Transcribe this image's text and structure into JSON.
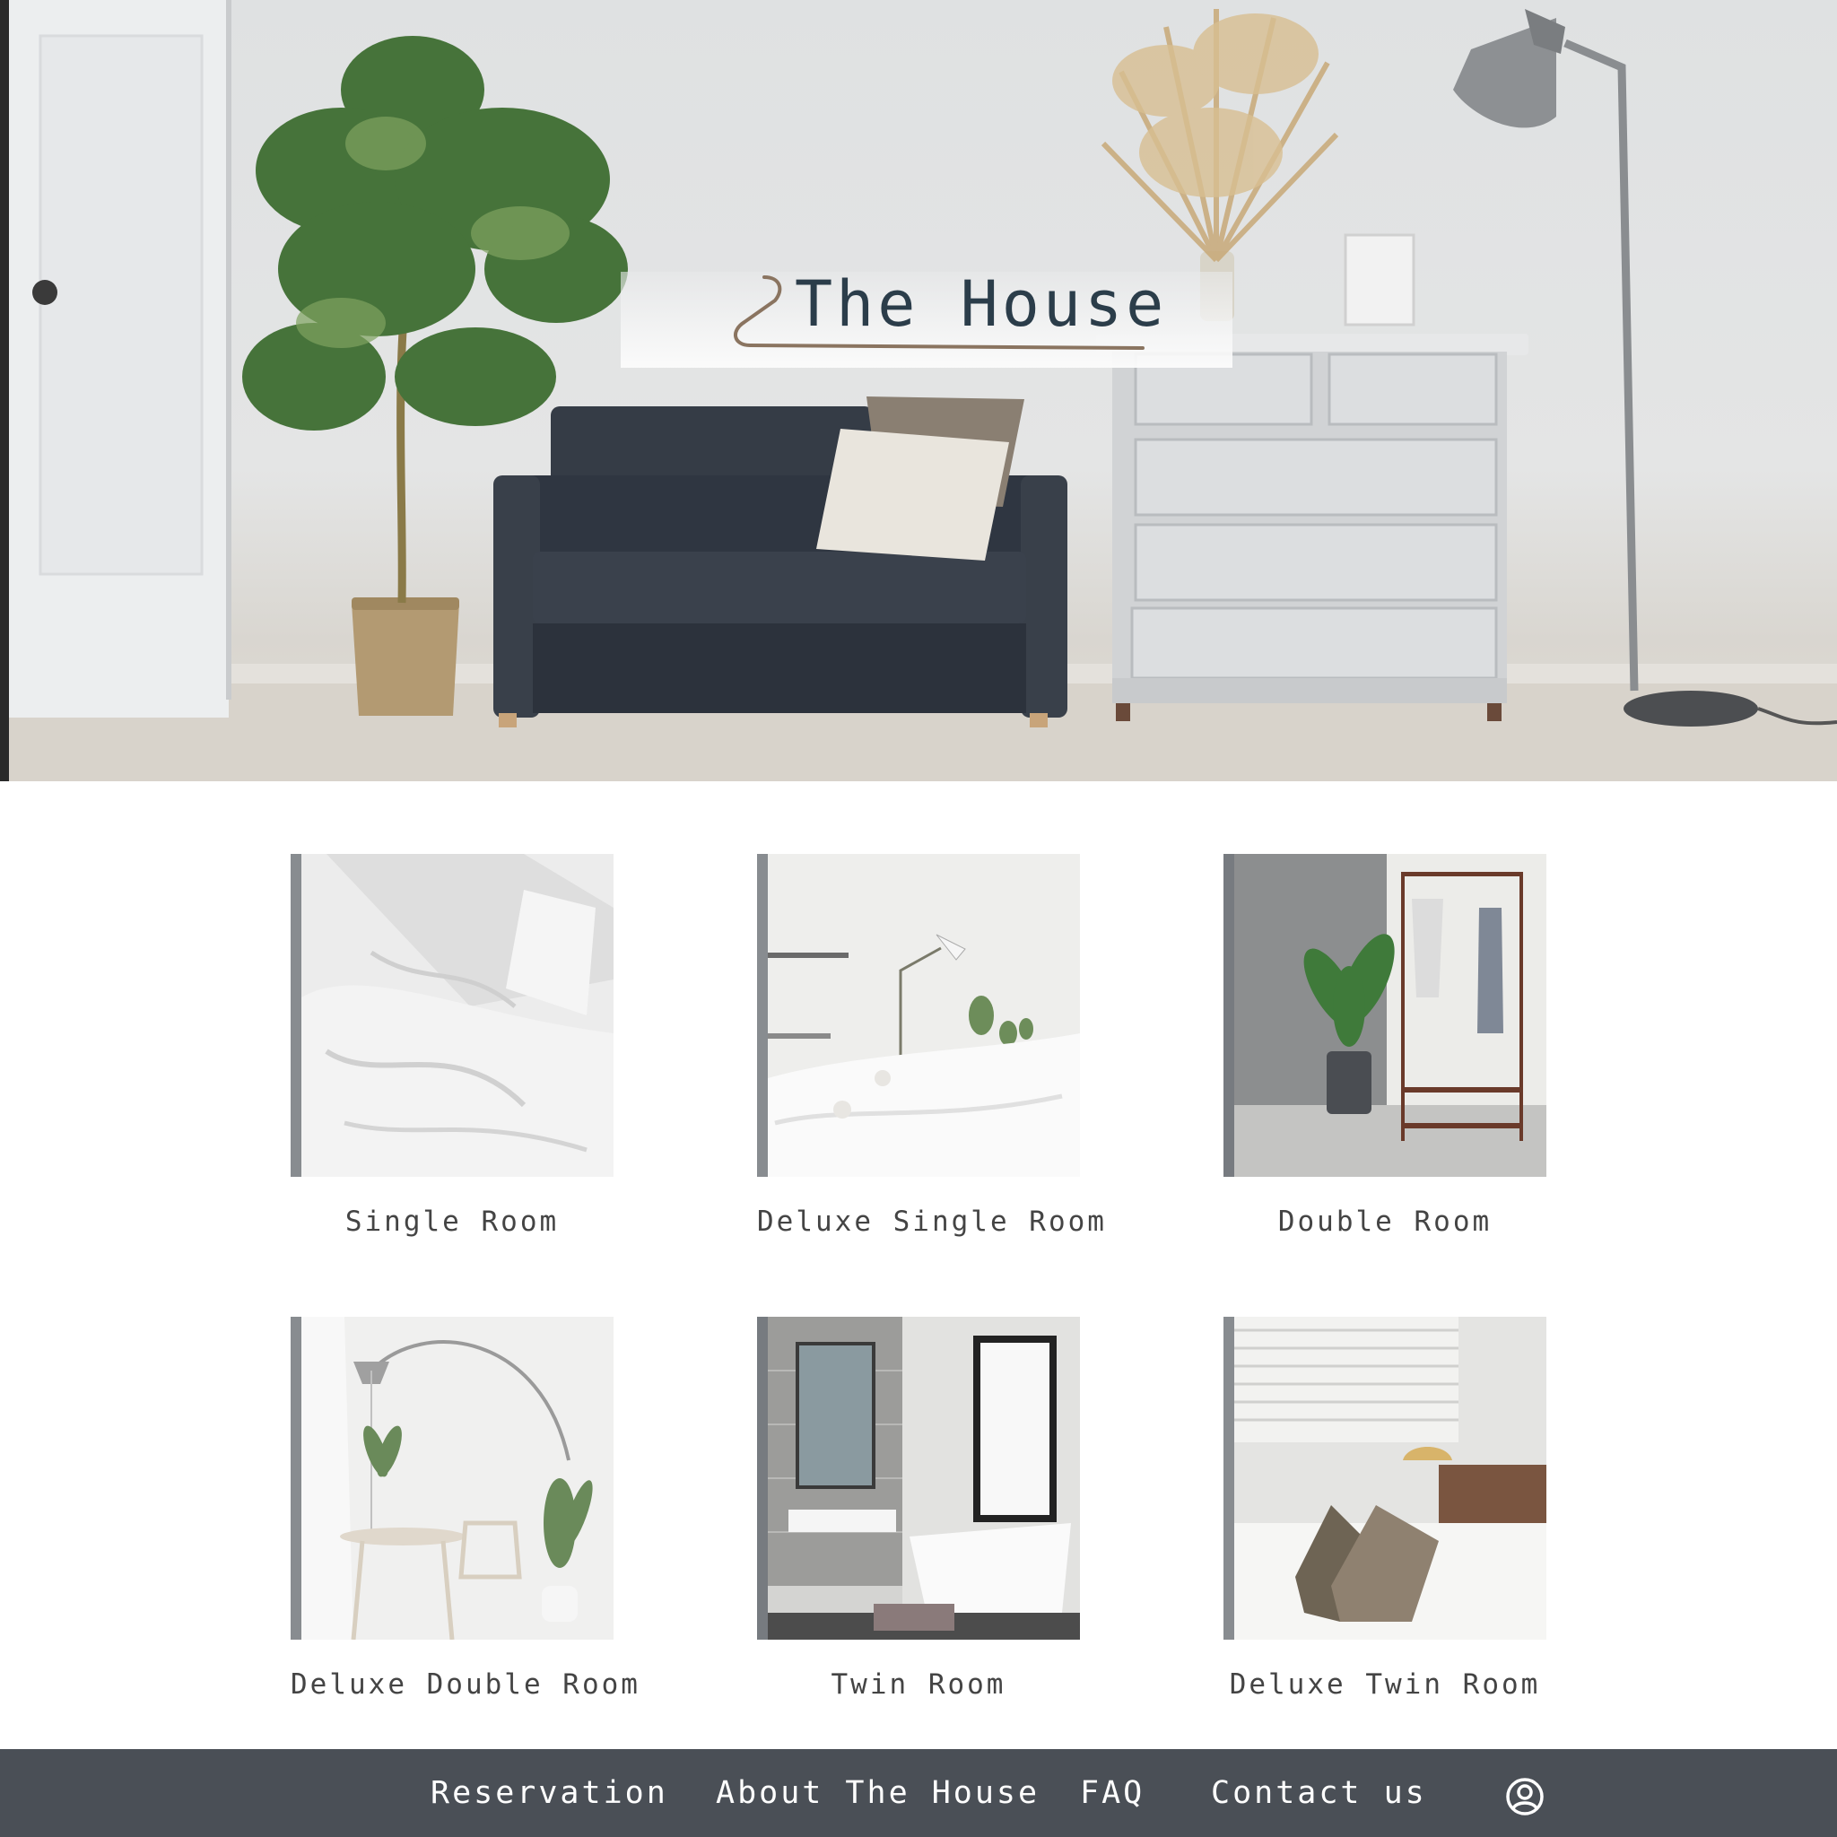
{
  "hero": {
    "title": "The House",
    "logo_icon": "hanger-icon"
  },
  "rooms": [
    {
      "name": "Single Room",
      "photo": "white-bedding-photo"
    },
    {
      "name": "Deluxe Single Room",
      "photo": "bright-bedroom-photo"
    },
    {
      "name": "Double Room",
      "photo": "clothes-rack-photo"
    },
    {
      "name": "Deluxe Double Room",
      "photo": "dining-corner-photo"
    },
    {
      "name": "Twin Room",
      "photo": "bathroom-photo"
    },
    {
      "name": "Deluxe Twin Room",
      "photo": "pillows-bed-photo"
    }
  ],
  "footer": {
    "nav": [
      "Reservation",
      "About The House",
      "FAQ",
      "Contact us"
    ],
    "account_icon": "user-circle-icon"
  },
  "colors": {
    "footer_bg": "#4a4f56",
    "title_text": "#2b3d4a",
    "label_text": "#444444",
    "logo_line": "#8a7460"
  }
}
